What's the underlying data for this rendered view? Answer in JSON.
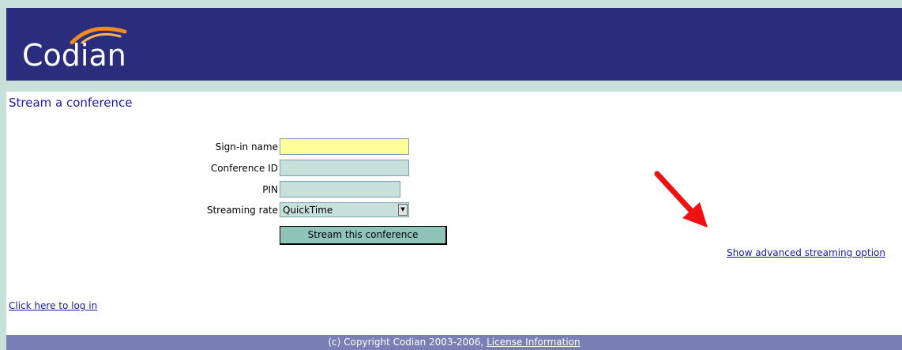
{
  "header": {
    "logo_text": "Codian"
  },
  "page": {
    "title": "Stream a conference"
  },
  "form": {
    "sign_in_label": "Sign-in name",
    "sign_in_value": "",
    "conference_id_label": "Conference ID",
    "conference_id_value": "",
    "pin_label": "PIN",
    "pin_value": "",
    "streaming_rate_label": "Streaming rate",
    "streaming_rate_value": "QuickTime",
    "submit_label": "Stream this conference"
  },
  "links": {
    "advanced": "Show advanced streaming option",
    "login": "Click here to log in"
  },
  "footer": {
    "copyright": "(c) Copyright Codian 2003-2006,",
    "license_link": "License Information"
  },
  "colors": {
    "header_bg": "#2a2d7d",
    "frame": "#c7e0d9",
    "footer_bg": "#7a7fb5",
    "link": "#1a1ab0",
    "annotation_arrow": "#ee1111"
  }
}
